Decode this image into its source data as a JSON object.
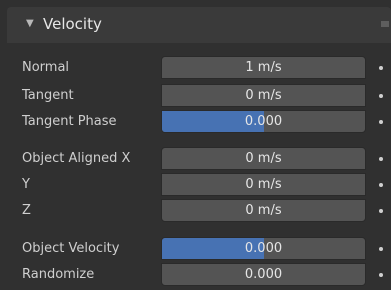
{
  "panel": {
    "title": "Velocity",
    "collapse_icon": "triangle-down-icon",
    "grip_icon": "drag-grip-icon"
  },
  "rows": {
    "normal": {
      "label": "Normal",
      "value": "1 m/s"
    },
    "tangent": {
      "label": "Tangent",
      "value": "0 m/s"
    },
    "tangent_phase": {
      "label": "Tangent Phase",
      "value": "0.000",
      "fill_fraction": 0.5
    },
    "obj_x": {
      "label": "Object Aligned X",
      "value": "0 m/s"
    },
    "obj_y": {
      "label": "Y",
      "value": "0 m/s"
    },
    "obj_z": {
      "label": "Z",
      "value": "0 m/s"
    },
    "obj_velocity": {
      "label": "Object Velocity",
      "value": "0.000",
      "fill_fraction": 0.5
    },
    "randomize": {
      "label": "Randomize",
      "value": "0.000"
    }
  },
  "colors": {
    "background": "#303030",
    "field": "#545454",
    "slider_fill": "#4772b3",
    "header": "#3a3a3a"
  }
}
